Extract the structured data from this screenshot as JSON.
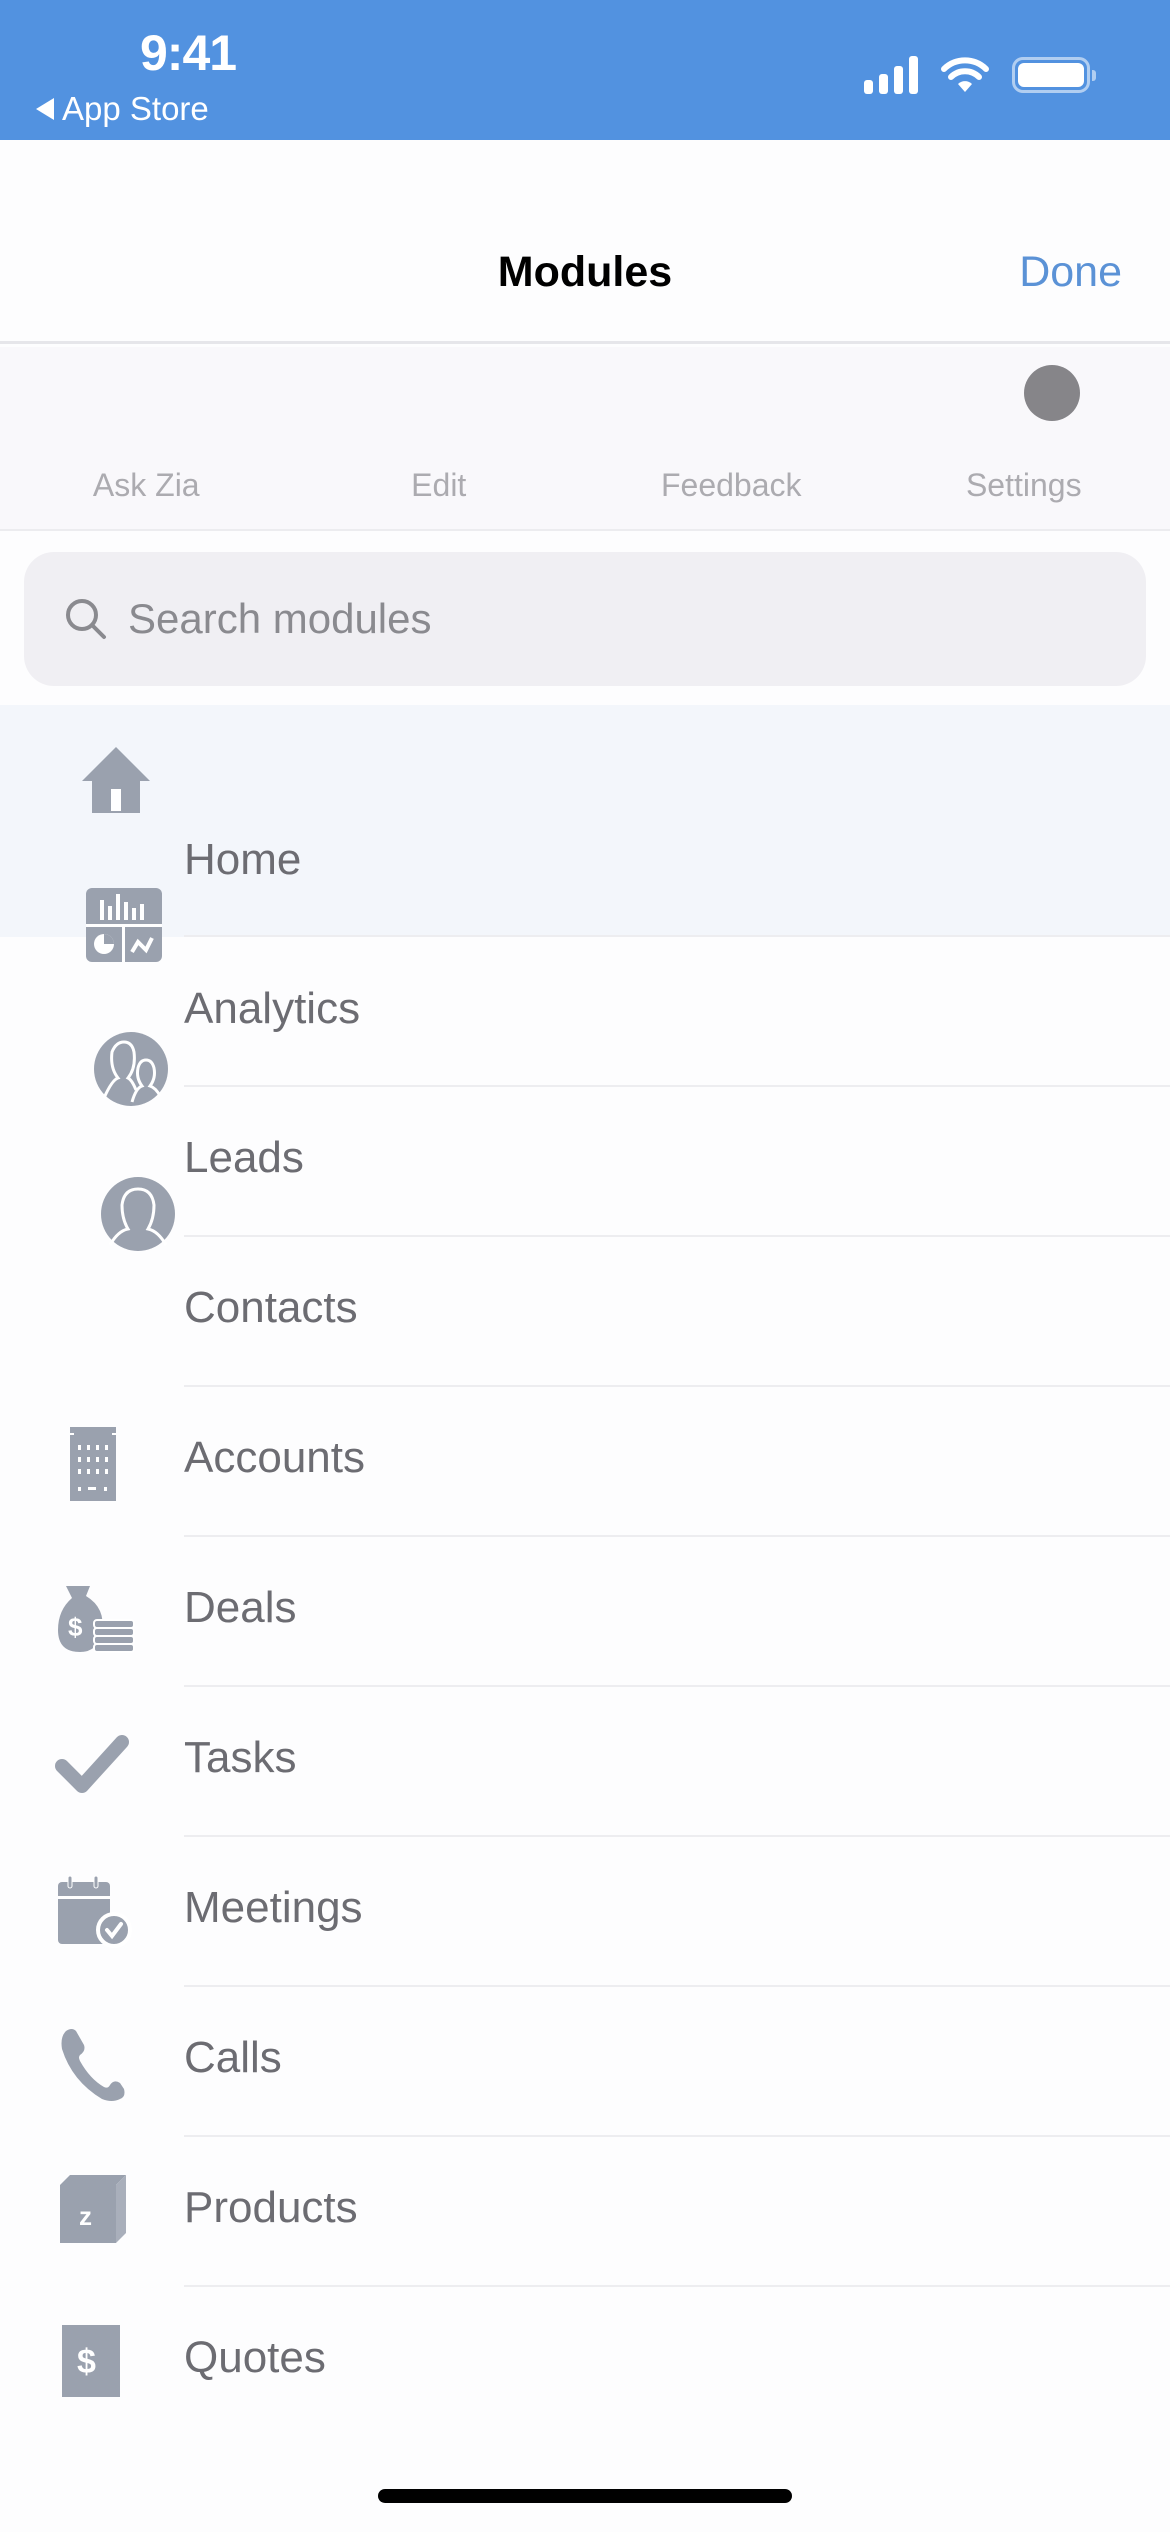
{
  "status_bar": {
    "time": "9:41",
    "back_app": "App Store",
    "icons": [
      "signal-icon",
      "wifi-icon",
      "battery-icon"
    ],
    "color": "#5292e0"
  },
  "navbar": {
    "title": "Modules",
    "done_label": "Done",
    "accent": "#5b92d6"
  },
  "actions": [
    {
      "label": "Ask Zia"
    },
    {
      "label": "Edit"
    },
    {
      "label": "Feedback"
    },
    {
      "label": "Settings"
    }
  ],
  "search": {
    "placeholder": "Search modules",
    "value": ""
  },
  "modules": [
    {
      "label": "Home",
      "icon": "home-icon",
      "selected": true
    },
    {
      "label": "Analytics",
      "icon": "analytics-icon"
    },
    {
      "label": "Leads",
      "icon": "leads-icon"
    },
    {
      "label": "Contacts",
      "icon": "contacts-icon"
    },
    {
      "label": "Accounts",
      "icon": "building-icon"
    },
    {
      "label": "Deals",
      "icon": "money-bag-icon"
    },
    {
      "label": "Tasks",
      "icon": "checkmark-icon"
    },
    {
      "label": "Meetings",
      "icon": "calendar-check-icon"
    },
    {
      "label": "Calls",
      "icon": "phone-icon"
    },
    {
      "label": "Products",
      "icon": "product-box-icon"
    },
    {
      "label": "Quotes",
      "icon": "quote-dollar-icon"
    }
  ],
  "icon_color": "#9aa1ae"
}
